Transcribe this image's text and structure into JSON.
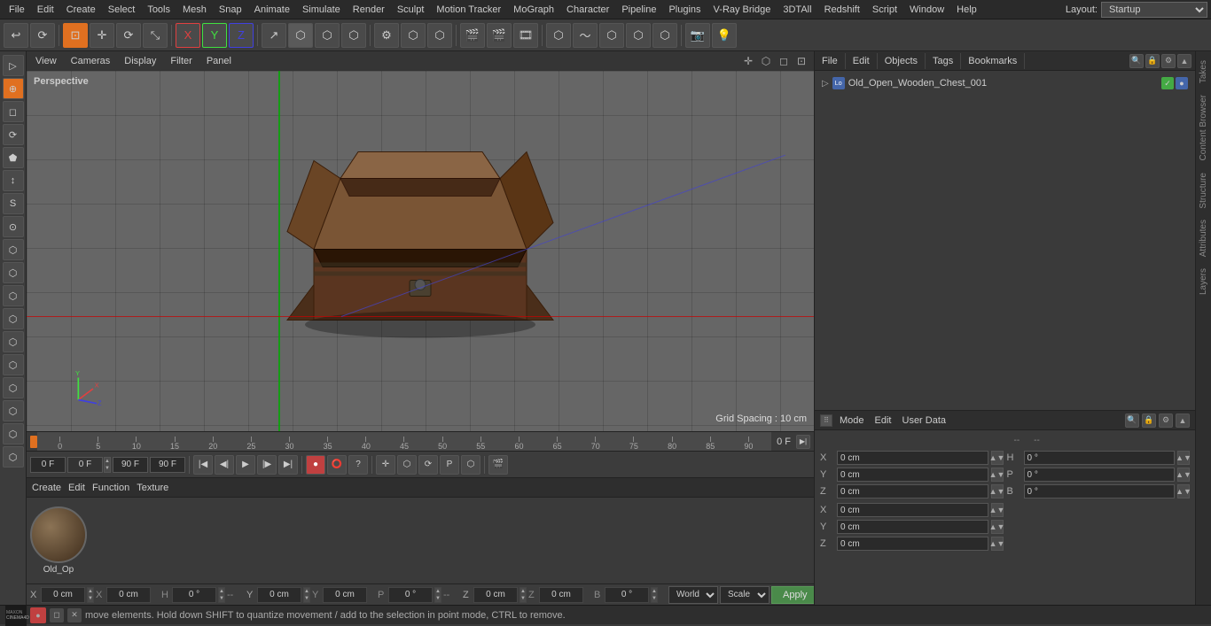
{
  "app": {
    "title": "Cinema 4D"
  },
  "menubar": {
    "items": [
      "File",
      "Edit",
      "Create",
      "Select",
      "Tools",
      "Mesh",
      "Snap",
      "Animate",
      "Simulate",
      "Render",
      "Sculpt",
      "Motion Tracker",
      "MoGraph",
      "Character",
      "Pipeline",
      "Plugins",
      "V-Ray Bridge",
      "3DTAll",
      "Redshift",
      "Script",
      "Window",
      "Help"
    ],
    "layout_label": "Layout:",
    "layout_value": "Startup"
  },
  "toolbar": {
    "undo_label": "↩",
    "tools": [
      "↩",
      "⊡",
      "✛",
      "⟳",
      "+",
      "X",
      "Y",
      "Z",
      "↗",
      "⬡",
      "⟳",
      "⚙",
      "+",
      "⬡",
      "⬡",
      "⬡",
      "🎬",
      "🎬",
      "🎬",
      "⬡",
      "⬡",
      "⬡",
      "⬡",
      "⬡",
      "⬡",
      "⬡",
      "📷",
      "💡"
    ]
  },
  "left_sidebar": {
    "tools": [
      "▷",
      "⊕",
      "◻",
      "⟳",
      "✚",
      "⬟",
      "↕",
      "S",
      "⊙",
      "⬡",
      "⬡",
      "⬡",
      "⬡",
      "⬡",
      "⬡",
      "⬡",
      "⬡",
      "⬡"
    ]
  },
  "viewport": {
    "header_items": [
      "View",
      "Cameras",
      "Display",
      "Filter",
      "Panel"
    ],
    "perspective_label": "Perspective",
    "grid_spacing": "Grid Spacing : 10 cm"
  },
  "timeline": {
    "marks": [
      "0",
      "5",
      "10",
      "15",
      "20",
      "25",
      "30",
      "35",
      "40",
      "45",
      "50",
      "55",
      "60",
      "65",
      "70",
      "75",
      "80",
      "85",
      "90"
    ],
    "frame_display": "0 F"
  },
  "playback": {
    "start_frame": "0 F",
    "current_frame": "0 F",
    "end_frame1": "90 F",
    "end_frame2": "90 F"
  },
  "object_manager": {
    "toolbar_items": [
      "File",
      "Edit",
      "Objects",
      "Tags",
      "Bookmarks"
    ],
    "objects": [
      {
        "name": "Old_Open_Wooden_Chest_001",
        "icon": "Lo",
        "vis1": "green",
        "vis2": "blue"
      }
    ]
  },
  "attributes": {
    "toolbar_items": [
      "Mode",
      "Edit",
      "User Data"
    ],
    "coords": {
      "x_pos": "0 cm",
      "y_pos": "0 cm",
      "z_pos": "0 cm",
      "x_rot": "0 °",
      "y_rot": "0 °",
      "z_rot": "0 °",
      "h_val": "0 °",
      "p_val": "0 °",
      "b_val": "0 °",
      "x_scale": "0 cm",
      "y_scale": "0 cm",
      "z_scale": "0 cm"
    },
    "world_options": [
      "World"
    ],
    "scale_options": [
      "Scale"
    ],
    "apply_label": "Apply",
    "world_selected": "World",
    "scale_selected": "Scale"
  },
  "material_panel": {
    "toolbar_items": [
      "Create",
      "Edit",
      "Function",
      "Texture"
    ],
    "material_name": "Old_Op"
  },
  "status_bar": {
    "message": "move elements. Hold down SHIFT to quantize movement / add to the selection in point mode, CTRL to remove."
  },
  "right_vtabs": [
    "Takes",
    "Content Browser",
    "Structure",
    "Attributes",
    "Layers"
  ],
  "coord_bar": {
    "x_label": "X",
    "y_label": "Y",
    "z_label": "Z",
    "x_val": "0 cm",
    "y_val": "0 cm",
    "z_val": "0 cm",
    "h_label": "H",
    "p_label": "P",
    "b_label": "B",
    "h_val": "0 °",
    "p_val": "0 °",
    "b_val": "0 °",
    "world_label": "World",
    "scale_label": "Scale",
    "apply_label": "Apply"
  }
}
